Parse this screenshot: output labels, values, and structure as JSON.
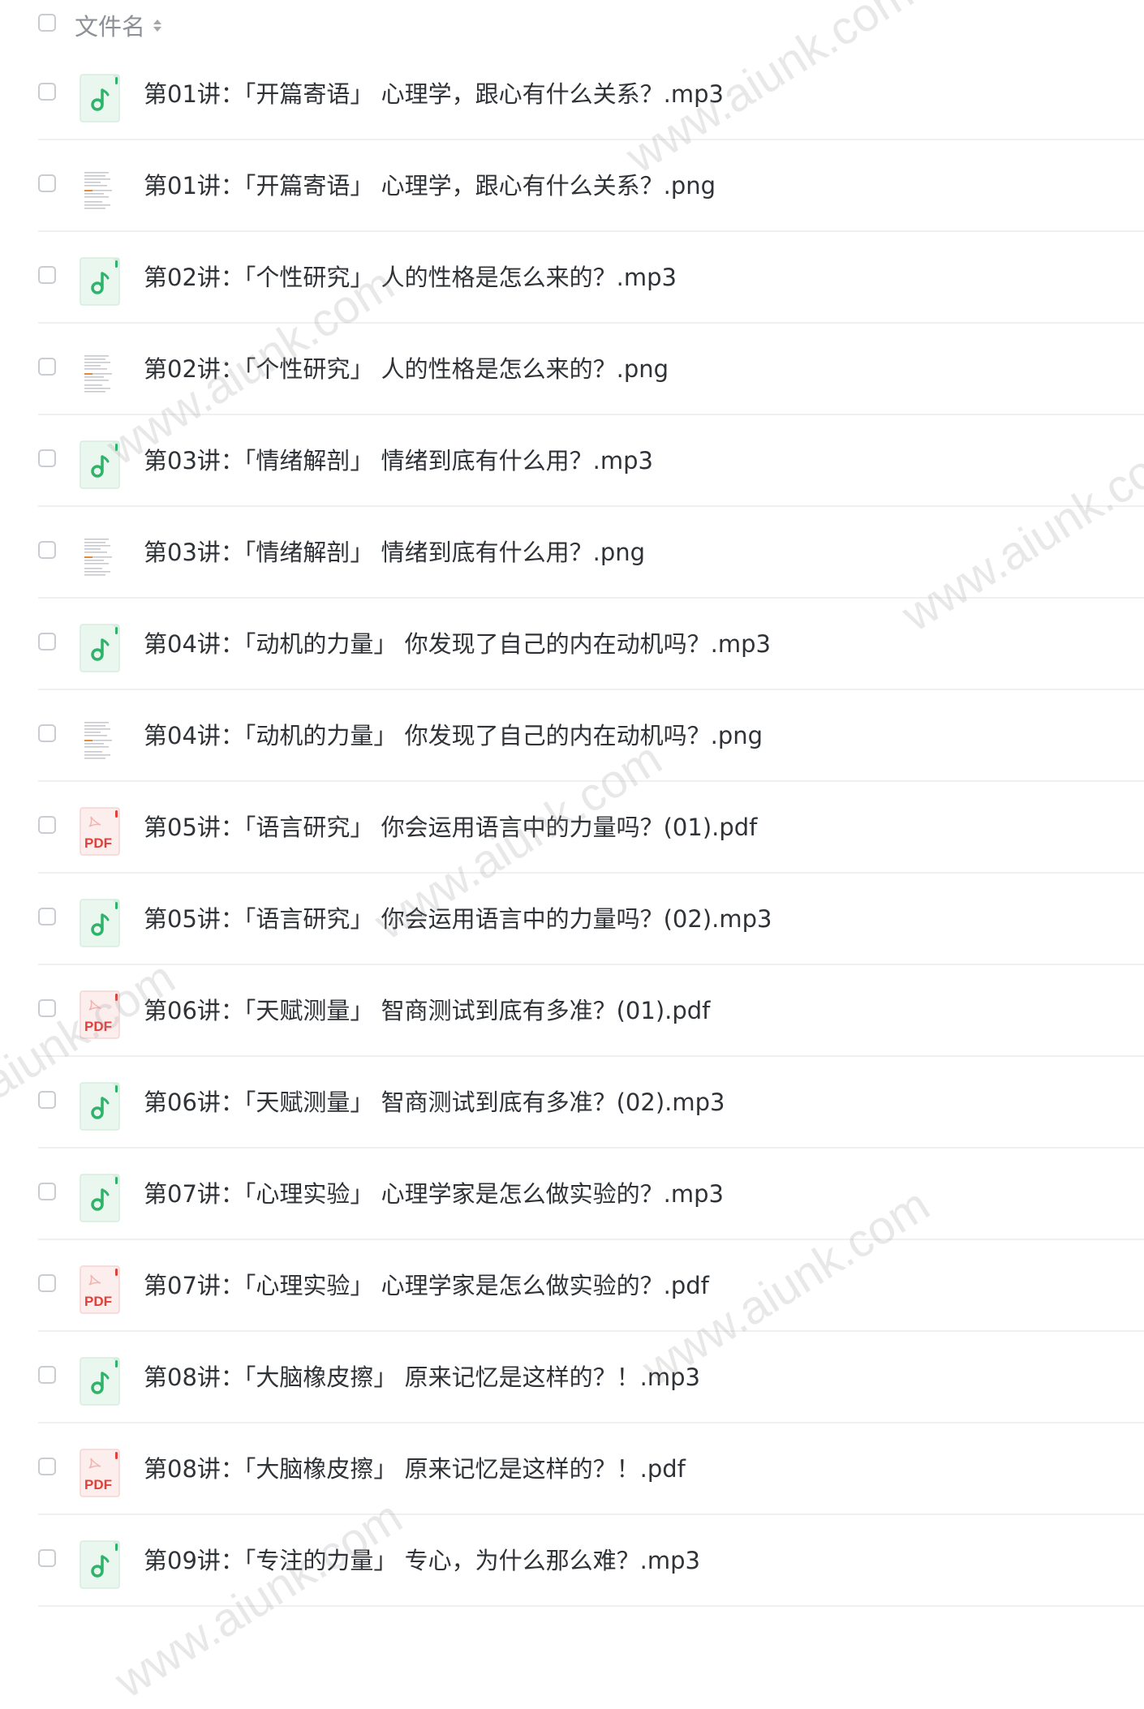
{
  "header": {
    "column_title": "文件名"
  },
  "files": [
    {
      "name": "第01讲：「开篇寄语」 心理学，跟心有什么关系？.mp3",
      "type": "mp3",
      "icon": "audio-file-icon"
    },
    {
      "name": "第01讲：「开篇寄语」 心理学，跟心有什么关系？.png",
      "type": "png",
      "icon": "image-thumbnail-icon"
    },
    {
      "name": "第02讲：「个性研究」 人的性格是怎么来的？.mp3",
      "type": "mp3",
      "icon": "audio-file-icon"
    },
    {
      "name": "第02讲：「个性研究」 人的性格是怎么来的？.png",
      "type": "png",
      "icon": "image-thumbnail-icon"
    },
    {
      "name": "第03讲：「情绪解剖」 情绪到底有什么用？.mp3",
      "type": "mp3",
      "icon": "audio-file-icon"
    },
    {
      "name": "第03讲：「情绪解剖」 情绪到底有什么用？.png",
      "type": "png",
      "icon": "image-thumbnail-icon"
    },
    {
      "name": "第04讲：「动机的力量」 你发现了自己的内在动机吗？.mp3",
      "type": "mp3",
      "icon": "audio-file-icon"
    },
    {
      "name": "第04讲：「动机的力量」 你发现了自己的内在动机吗？.png",
      "type": "png",
      "icon": "image-thumbnail-icon"
    },
    {
      "name": "第05讲：「语言研究」 你会运用语言中的力量吗？(01).pdf",
      "type": "pdf",
      "icon": "pdf-file-icon"
    },
    {
      "name": "第05讲：「语言研究」 你会运用语言中的力量吗？(02).mp3",
      "type": "mp3",
      "icon": "audio-file-icon"
    },
    {
      "name": "第06讲：「天赋测量」 智商测试到底有多准？(01).pdf",
      "type": "pdf",
      "icon": "pdf-file-icon"
    },
    {
      "name": "第06讲：「天赋测量」 智商测试到底有多准？(02).mp3",
      "type": "mp3",
      "icon": "audio-file-icon"
    },
    {
      "name": "第07讲：「心理实验」 心理学家是怎么做实验的？.mp3",
      "type": "mp3",
      "icon": "audio-file-icon"
    },
    {
      "name": "第07讲：「心理实验」 心理学家是怎么做实验的？.pdf",
      "type": "pdf",
      "icon": "pdf-file-icon"
    },
    {
      "name": "第08讲：「大脑橡皮擦」 原来记忆是这样的？！.mp3",
      "type": "mp3",
      "icon": "audio-file-icon"
    },
    {
      "name": "第08讲：「大脑橡皮擦」 原来记忆是这样的？！.pdf",
      "type": "pdf",
      "icon": "pdf-file-icon"
    },
    {
      "name": "第09讲：「专注的力量」 专心，为什么那么难？.mp3",
      "type": "mp3",
      "icon": "audio-file-icon"
    }
  ],
  "pdf_icon_label": "PDF",
  "watermark_text": "www.aiunk.com",
  "colors": {
    "audio_green": "#2fb36a",
    "pdf_red": "#e0403a",
    "text": "#2f3236",
    "header_text": "#8d9096"
  }
}
